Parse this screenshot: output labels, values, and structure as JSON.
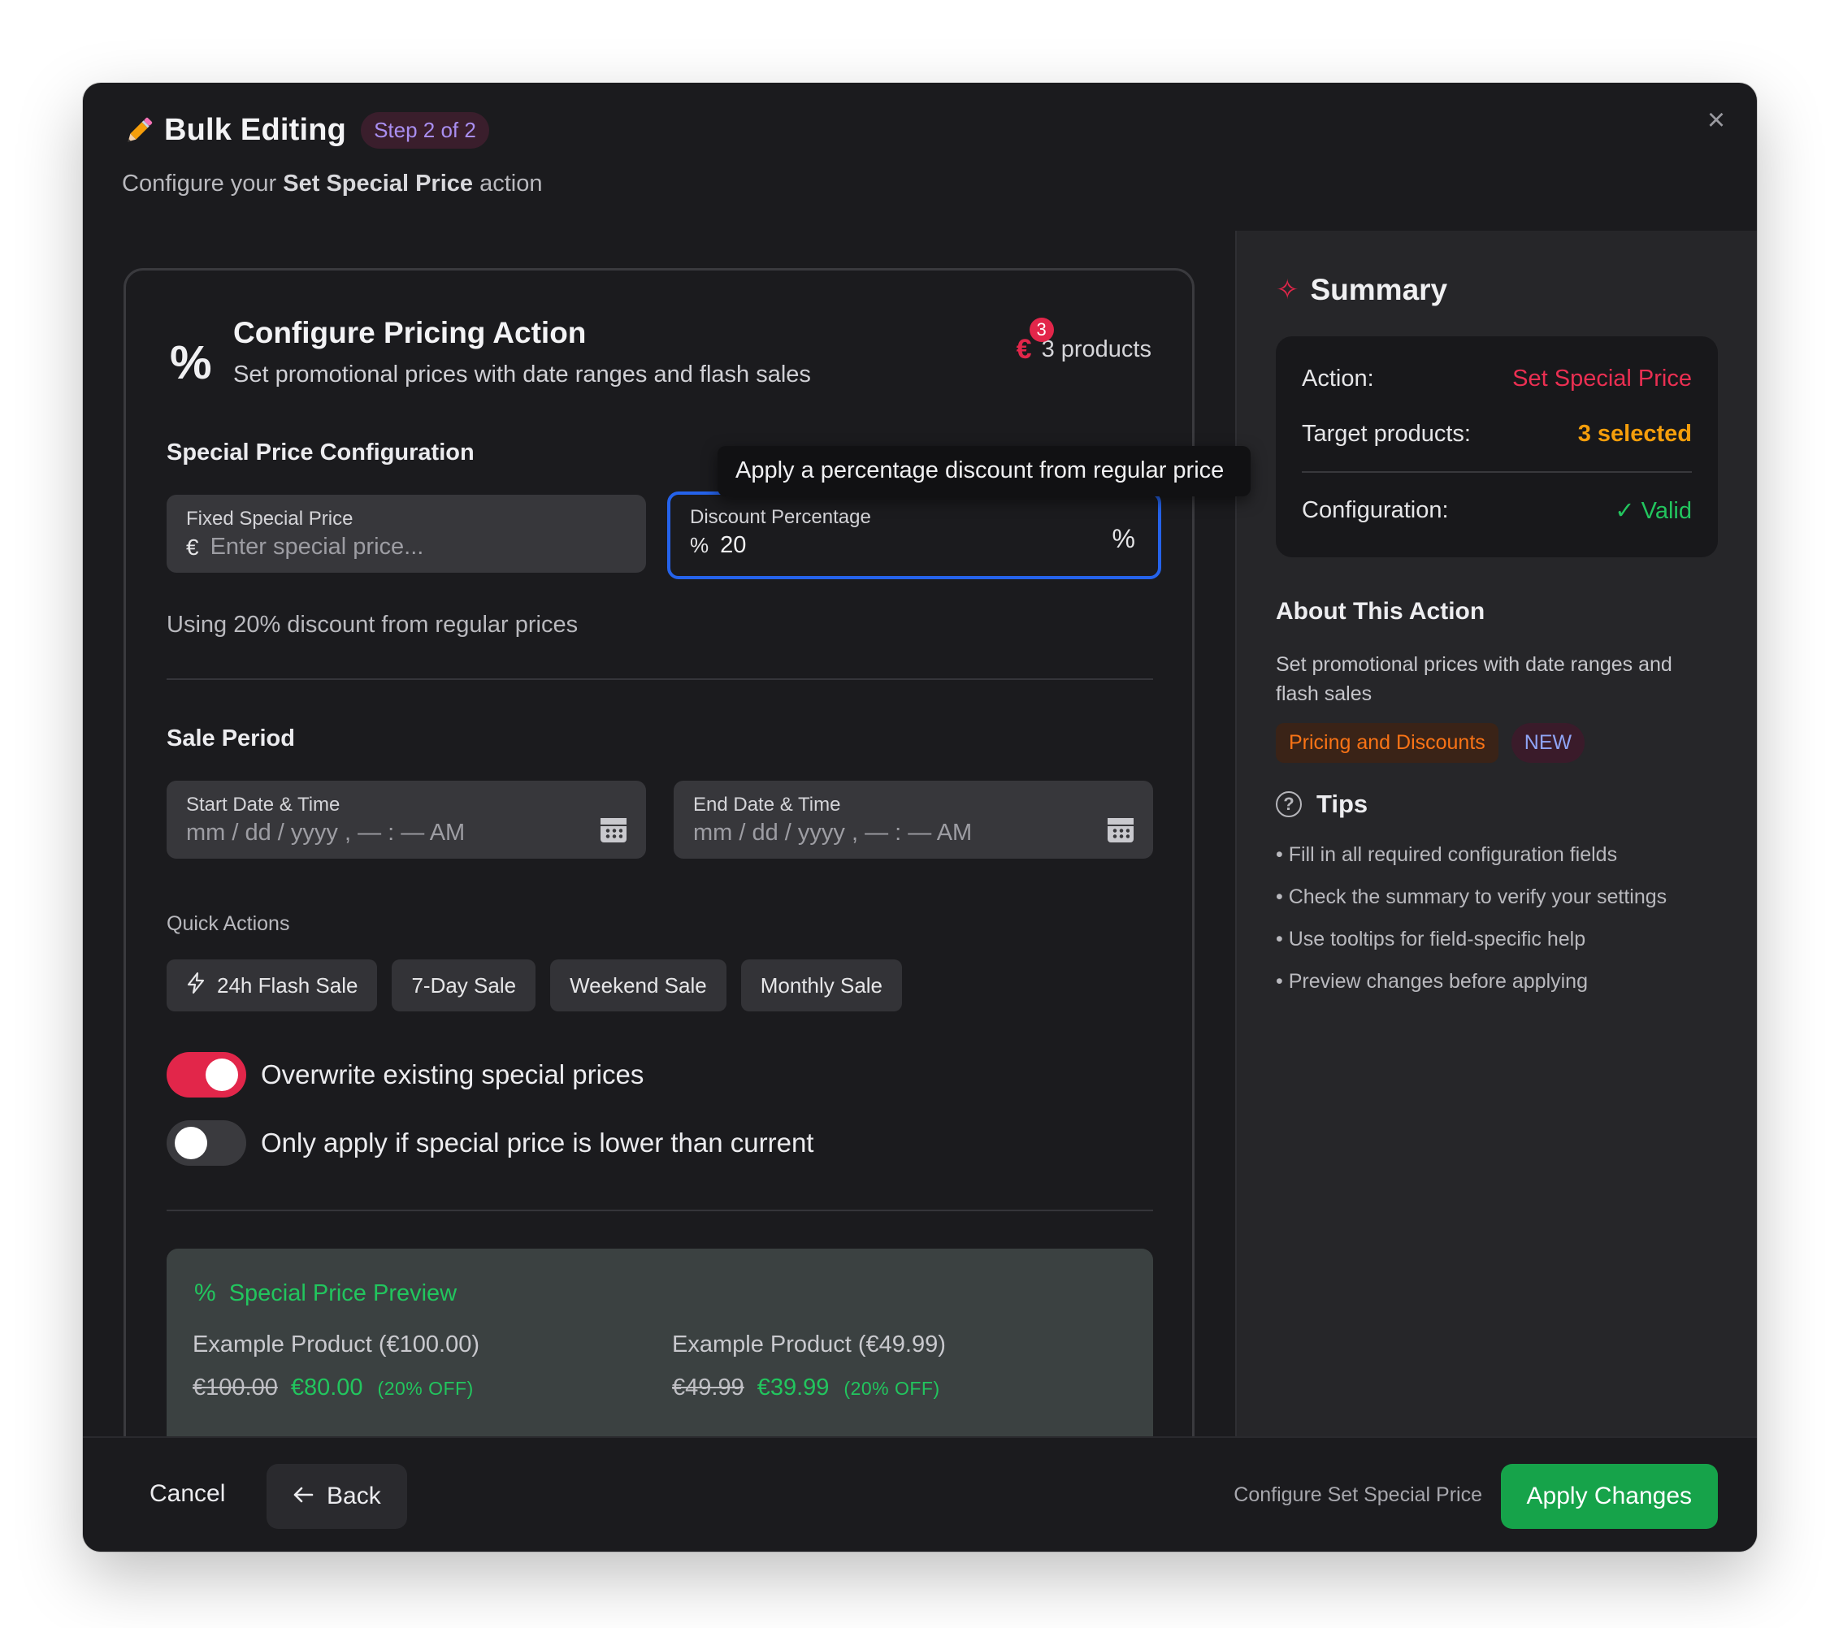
{
  "header": {
    "title": "Bulk Editing",
    "step_badge": "Step 2 of 2",
    "subtitle_prefix": "Configure your",
    "subtitle_action": "Set Special Price",
    "subtitle_suffix": "action",
    "close_icon": "×"
  },
  "card": {
    "title": "Configure Pricing Action",
    "subtitle": "Set promotional prices with date ranges and flash sales",
    "product_badge_count": "3",
    "product_count_label": "3 products"
  },
  "special_price": {
    "section_title": "Special Price Configuration",
    "fixed_label": "Fixed Special Price",
    "fixed_currency": "€",
    "fixed_placeholder": "Enter special price...",
    "discount_label": "Discount Percentage",
    "discount_value": "20",
    "discount_unit": "%",
    "tooltip": "Apply a percentage discount from regular price",
    "hint": "Using 20% discount from regular prices"
  },
  "sale_period": {
    "section_title": "Sale Period",
    "start_label": "Start Date & Time",
    "start_placeholder": "mm / dd / yyyy ,  — : —  AM",
    "end_label": "End Date & Time",
    "end_placeholder": "mm / dd / yyyy ,  — : —  AM",
    "quick_actions_label": "Quick Actions",
    "quick_actions": [
      "24h Flash Sale",
      "7-Day Sale",
      "Weekend Sale",
      "Monthly Sale"
    ]
  },
  "toggles": {
    "overwrite_label": "Overwrite existing special prices",
    "overwrite_on": true,
    "lower_only_label": "Only apply if special price is lower than current",
    "lower_only_on": false
  },
  "preview": {
    "title": "Special Price Preview",
    "items": [
      {
        "name": "Example Product (€100.00)",
        "old": "€100.00",
        "new": "€80.00",
        "off": "(20% OFF)"
      },
      {
        "name": "Example Product (€49.99)",
        "old": "€49.99",
        "new": "€39.99",
        "off": "(20% OFF)"
      }
    ]
  },
  "summary": {
    "title": "Summary",
    "action_label": "Action:",
    "action_value": "Set Special Price",
    "target_label": "Target products:",
    "target_value": "3 selected",
    "config_label": "Configuration:",
    "config_value": "✓ Valid"
  },
  "about": {
    "title": "About This Action",
    "text": "Set promotional prices with date ranges and flash sales",
    "category_tag": "Pricing and Discounts",
    "new_tag": "NEW"
  },
  "tips": {
    "title": "Tips",
    "items": [
      "• Fill in all required configuration fields",
      "• Check the summary to verify your settings",
      "• Use tooltips for field-specific help",
      "• Preview changes before applying"
    ]
  },
  "footer": {
    "cancel": "Cancel",
    "back": "Back",
    "hint": "Configure Set Special Price",
    "apply": "Apply Changes"
  },
  "colors": {
    "accent_red": "#e2264a",
    "valid_green": "#22c55e",
    "apply_green": "#16a34a",
    "focus_blue": "#2563eb",
    "target_orange": "#f59e0b"
  }
}
